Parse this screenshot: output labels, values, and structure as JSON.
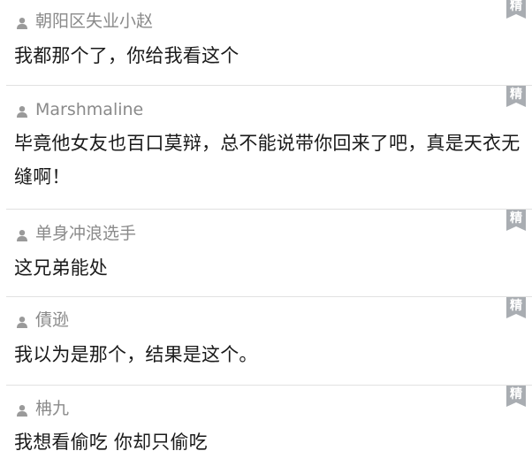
{
  "badge_label": "精",
  "colors": {
    "badge_bg": "#a9adb2",
    "author_text": "#8a8a8a",
    "content_text": "#1a1a1a",
    "divider": "#e1e1e1"
  },
  "icons": {
    "author": "user-icon",
    "badge": "jing-badge-icon"
  },
  "comments": [
    {
      "author": "朝阳区失业小赵",
      "content": "我都那个了，你给我看这个"
    },
    {
      "author": "Marshmaline",
      "content": "毕竟他女友也百口莫辩，总不能说带你回来了吧，真是天衣无缝啊！"
    },
    {
      "author": "单身冲浪选手",
      "content": "这兄弟能处"
    },
    {
      "author": "債逊",
      "content": "我以为是那个，结果是这个。"
    },
    {
      "author": "柟九",
      "content": "我想看偷吃 你却只偷吃"
    }
  ]
}
